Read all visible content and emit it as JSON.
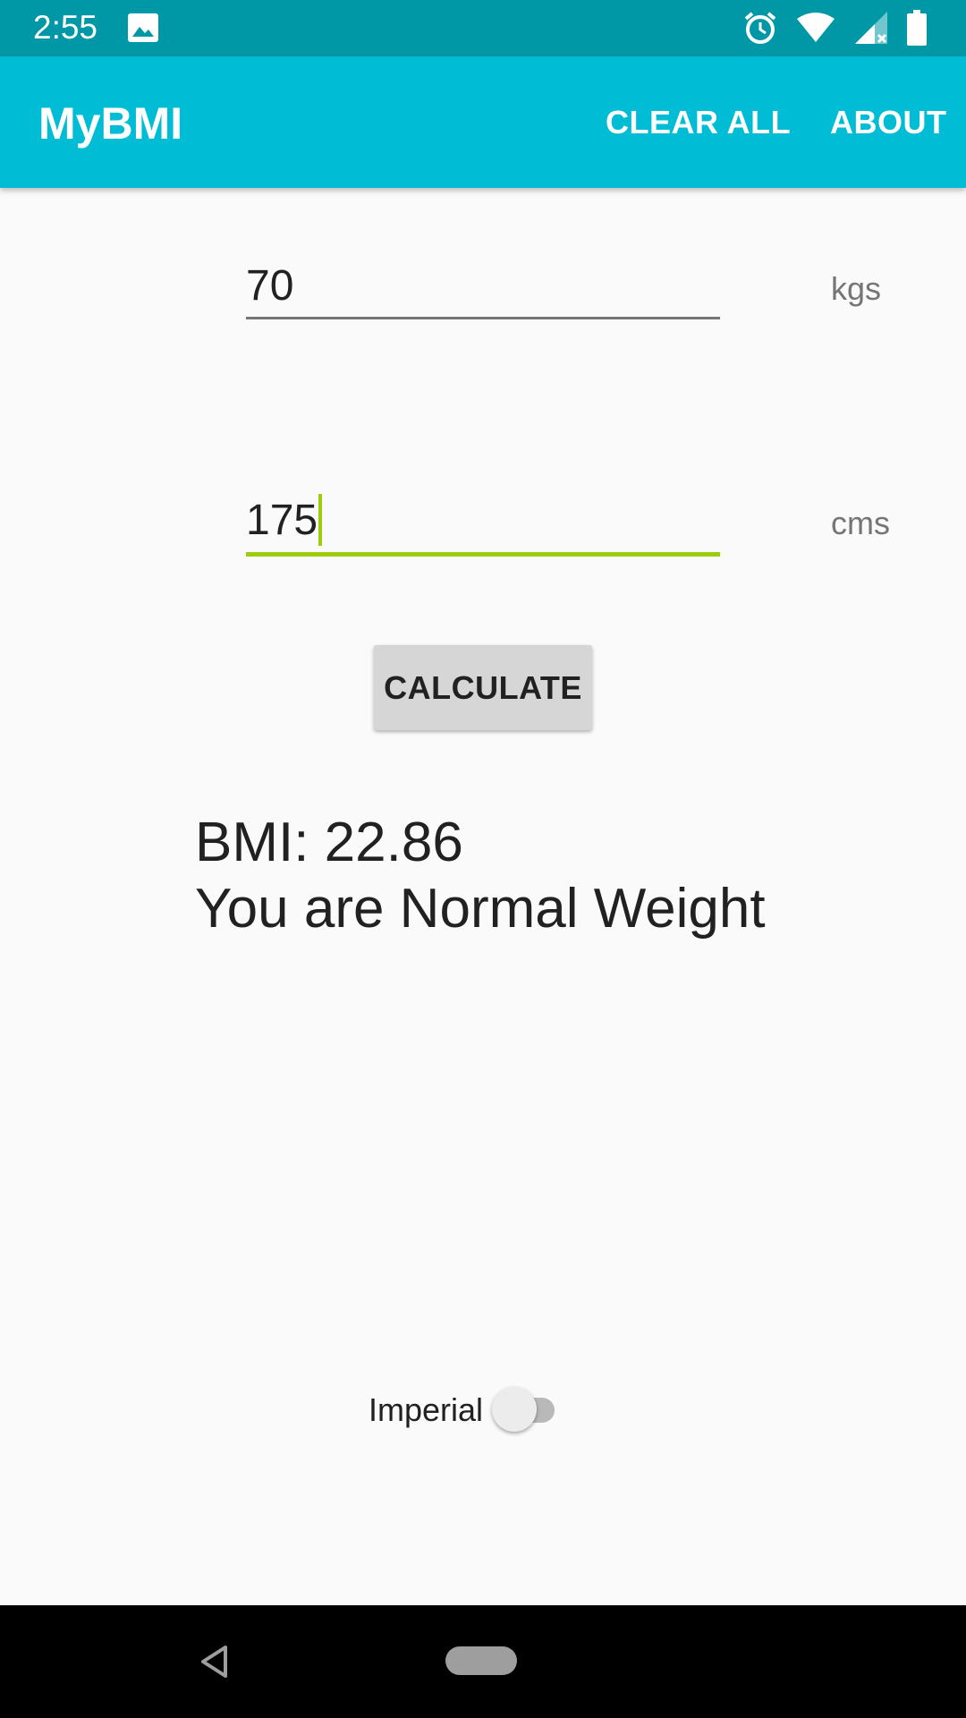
{
  "status_bar": {
    "time": "2:55",
    "icons": [
      "gallery-icon",
      "alarm-icon",
      "wifi-icon",
      "signal-icon",
      "battery-icon"
    ]
  },
  "app_bar": {
    "title": "MyBMI",
    "actions": {
      "clear_all": "CLEAR ALL",
      "about": "ABOUT"
    }
  },
  "weight": {
    "value": "70",
    "unit": "kgs"
  },
  "height": {
    "value": "175",
    "unit": "cms"
  },
  "calculate_label": "CALCULATE",
  "result": {
    "bmi_line": "BMI: 22.86",
    "category_line": "You are Normal Weight"
  },
  "imperial": {
    "label": "Imperial",
    "enabled": false
  },
  "colors": {
    "status_bar": "#0097a7",
    "app_bar": "#00bcd4",
    "focus_accent": "#9ccc0c",
    "background": "#fafafa"
  }
}
